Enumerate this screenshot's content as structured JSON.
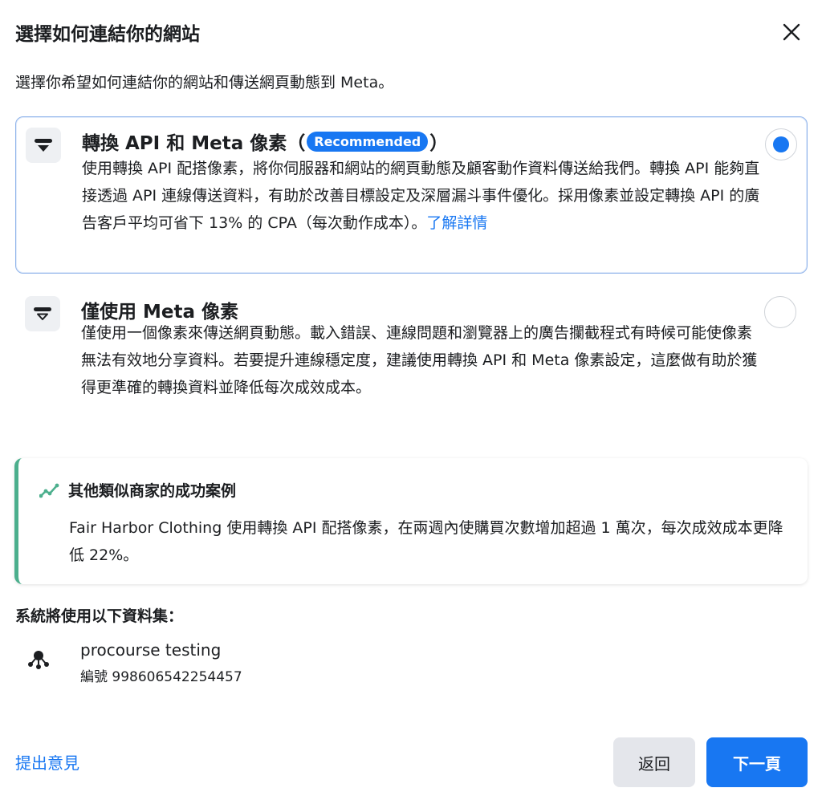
{
  "header": {
    "title": "選擇如何連結你的網站",
    "close_icon": "close-icon"
  },
  "subtitle": "選擇你希望如何連結你的網站和傳送網頁動態到 Meta。",
  "options": [
    {
      "title_prefix": "轉換 API 和 Meta 像素（",
      "badge": "Recommended",
      "title_suffix": "）",
      "description": "使用轉換 API 配搭像素，將你伺服器和網站的網頁動態及顧客動作資料傳送給我們。轉換 API 能夠直接透過 API 連線傳送資料，有助於改善目標設定及深層漏斗事件優化。採用像素並設定轉換 API 的廣告客戶平均可省下 13% 的 CPA（每次動作成本）。",
      "link": "了解詳情",
      "selected": true,
      "icon": "capi-pixel-icon"
    },
    {
      "title": "僅使用 Meta 像素",
      "description": "僅使用一個像素來傳送網頁動態。載入錯誤、連線問題和瀏覽器上的廣告攔截程式有時候可能使像素無法有效地分享資料。若要提升連線穩定度，建議使用轉換 API 和 Meta 像素設定，這麼做有助於獲得更準確的轉換資料並降低每次成效成本。",
      "selected": false,
      "icon": "pixel-icon"
    }
  ],
  "case_study": {
    "title": "其他類似商家的成功案例",
    "text": "Fair Harbor Clothing 使用轉換 API 配搭像素，在兩週內使購買次數增加超過 1 萬次，每次成效成本更降低 22%。",
    "accent_color": "#4caf8d",
    "icon": "trend-chart-icon"
  },
  "dataset": {
    "heading": "系統將使用以下資料集：",
    "name": "procourse testing",
    "id_text": "編號 998606542254457",
    "icon": "dataset-icon"
  },
  "footer": {
    "feedback": "提出意見",
    "back": "返回",
    "next": "下一頁"
  },
  "colors": {
    "primary": "#1877f2",
    "text": "#1c1e21",
    "secondary_button": "#e4e6eb"
  }
}
